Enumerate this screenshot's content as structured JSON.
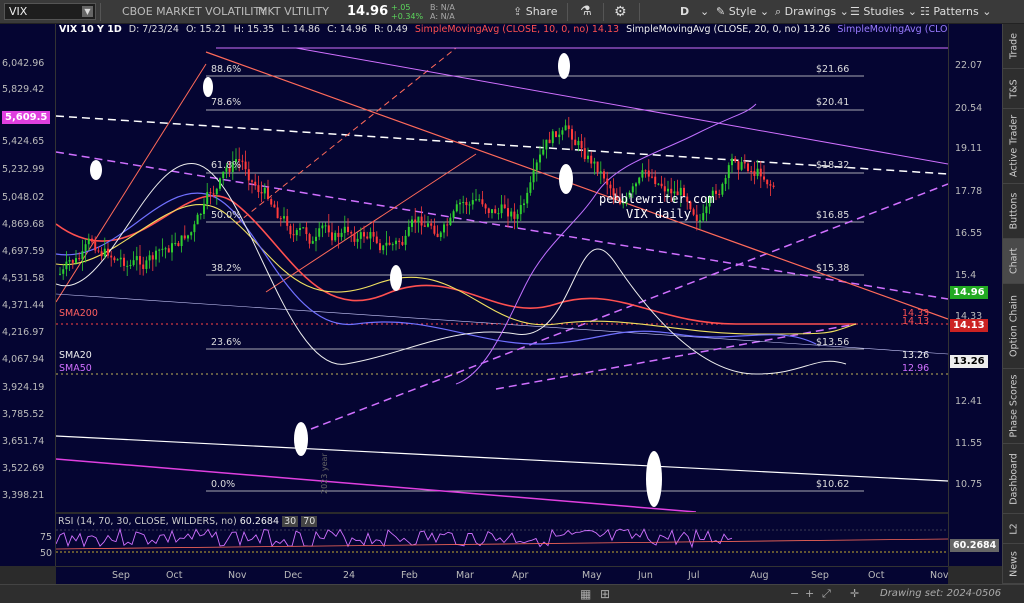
{
  "toolbar": {
    "symbol": "VIX",
    "description": "CBOE MARKET VOLATILITY",
    "short_name": "MKT VLTILITY",
    "last_price": "14.96",
    "change": "+.05",
    "change_pct": "+0.34%",
    "bid": "B: N/A",
    "ask": "A: N/A",
    "share_label": "Share",
    "flask_icon": "flask-icon",
    "gear_icon": "gear-icon",
    "d_label": "D",
    "style_label": "Style",
    "drawings_label": "Drawings",
    "studies_label": "Studies",
    "patterns_label": "Patterns"
  },
  "infobar": {
    "title": "VIX 10 Y 1D",
    "date": "D: 7/23/24",
    "open": "O: 15.21",
    "high": "H: 15.35",
    "low": "L: 14.86",
    "close": "C: 14.96",
    "range": "R: 0.49",
    "sma10": "SimpleMovingAvg (CLOSE, 10, 0, no)",
    "sma10_val": "14.13",
    "sma20": "SimpleMovingAvg (CLOSE, 20, 0, no)",
    "sma20_val": "13.26",
    "sma50": "SimpleMovingAvg (CLOSE,"
  },
  "left_axis": [
    "6,042.96",
    "5,829.42",
    "5,609.5",
    "5,424.65",
    "5,232.99",
    "5,048.02",
    "4,869.68",
    "4,697.59",
    "4,531.58",
    "4,371.44",
    "4,216.97",
    "4,067.94",
    "3,924.19",
    "3,785.52",
    "3,651.74",
    "3,522.69",
    "3,398.21"
  ],
  "right_axis": [
    "22.07",
    "20.54",
    "19.11",
    "17.78",
    "16.55",
    "15.4",
    "14.33",
    "13.33",
    "12.41",
    "11.55",
    "10.75"
  ],
  "x_labels": [
    "Sep",
    "Oct",
    "Nov",
    "Dec",
    "24",
    "Feb",
    "Mar",
    "Apr",
    "May",
    "Jun",
    "Jul",
    "Aug",
    "Sep",
    "Oct",
    "Nov"
  ],
  "fib": [
    {
      "pct": "88.6%",
      "price": "$21.66"
    },
    {
      "pct": "78.6%",
      "price": "$20.41"
    },
    {
      "pct": "61.8%",
      "price": "$18.32"
    },
    {
      "pct": "50.0%",
      "price": "$16.85"
    },
    {
      "pct": "38.2%",
      "price": "$15.38"
    },
    {
      "pct": "23.6%",
      "price": "$13.56"
    },
    {
      "pct": "0.0%",
      "price": "$10.62"
    }
  ],
  "annotations": {
    "watermark": "pebblewriter.com",
    "subtitle": "VIX daily",
    "year_label": "2023 year",
    "sma20_legend": "SMA20",
    "sma50_legend": "SMA50",
    "sma200_legend": "SMA200",
    "lbl_1326": "13.26",
    "lbl_1296": "12.96",
    "lbl_1433": "14.33",
    "lbl_1413": "14.13"
  },
  "price_flags": {
    "spx": "5,609.5",
    "last": "14.96",
    "sma10": "14.13",
    "sma20": "13.26",
    "spx_color": "#e040e0",
    "last_color": "#22aa22",
    "sma10_color": "#cc2222"
  },
  "rsi": {
    "label": "RSI (14, 70, 30, CLOSE, WILDERS, no)",
    "value": "60.2684",
    "low": "30",
    "high": "70",
    "tick_75": "75",
    "tick_50": "50"
  },
  "sidebar": [
    "Trade",
    "T&S",
    "Active Trader",
    "Buttons",
    "Chart",
    "Option Chain",
    "Phase Scores",
    "Dashboard",
    "L2",
    "News"
  ],
  "footer": {
    "drawing_set": "Drawing set: 2024-0506"
  }
}
